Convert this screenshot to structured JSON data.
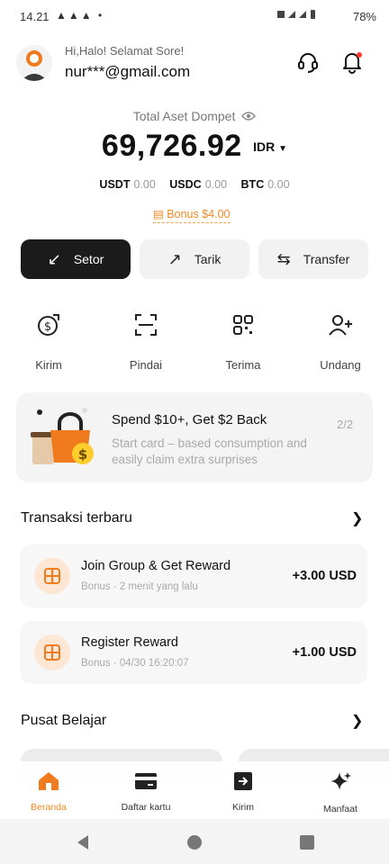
{
  "status_bar": {
    "time": "14.21",
    "left_icons": "▲▲▲ •",
    "battery": "78%",
    "icons": [
      "notification-icon",
      "wifi-icon",
      "signal-icon",
      "battery-icon"
    ]
  },
  "header": {
    "greeting": "Hi,Halo! Selamat Sore!",
    "email": "nur***@gmail.com"
  },
  "wallet": {
    "label": "Total Aset Dompet",
    "balance": "69,726.92",
    "currency": "IDR",
    "coins": [
      {
        "name": "USDT",
        "value": "0.00"
      },
      {
        "name": "USDC",
        "value": "0.00"
      },
      {
        "name": "BTC",
        "value": "0.00"
      }
    ],
    "bonus": "Bonus $4.00"
  },
  "actions": {
    "setor": "Setor",
    "tarik": "Tarik",
    "transfer": "Transfer"
  },
  "quick_actions": [
    {
      "label": "Kirim",
      "icon": "send-dollar-icon"
    },
    {
      "label": "Pindai",
      "icon": "scan-icon"
    },
    {
      "label": "Terima",
      "icon": "qr-code-icon"
    },
    {
      "label": "Undang",
      "icon": "invite-user-icon"
    }
  ],
  "promo": {
    "title": "Spend $10+, Get $2 Back",
    "subtitle": "Start card – based consumption and easily claim extra surprises",
    "page": "2/2"
  },
  "transactions": {
    "title": "Transaksi terbaru",
    "items": [
      {
        "title": "Join Group & Get Reward",
        "subtitle": "Bonus · 2 menit yang lalu",
        "amount": "+3.00 USD"
      },
      {
        "title": "Register Reward",
        "subtitle": "Bonus · 04/30 16:20:07",
        "amount": "+1.00 USD"
      }
    ]
  },
  "learning": {
    "title": "Pusat Belajar"
  },
  "bottom_nav": [
    {
      "label": "Beranda",
      "icon": "home-icon",
      "active": true
    },
    {
      "label": "Daftar kartu",
      "icon": "card-icon",
      "active": false
    },
    {
      "label": "Kirim",
      "icon": "send-icon",
      "active": false
    },
    {
      "label": "Manfaat",
      "icon": "sparkle-icon",
      "active": false
    }
  ],
  "colors": {
    "accent": "#f08a24",
    "dark_button": "#1b1b1b"
  }
}
